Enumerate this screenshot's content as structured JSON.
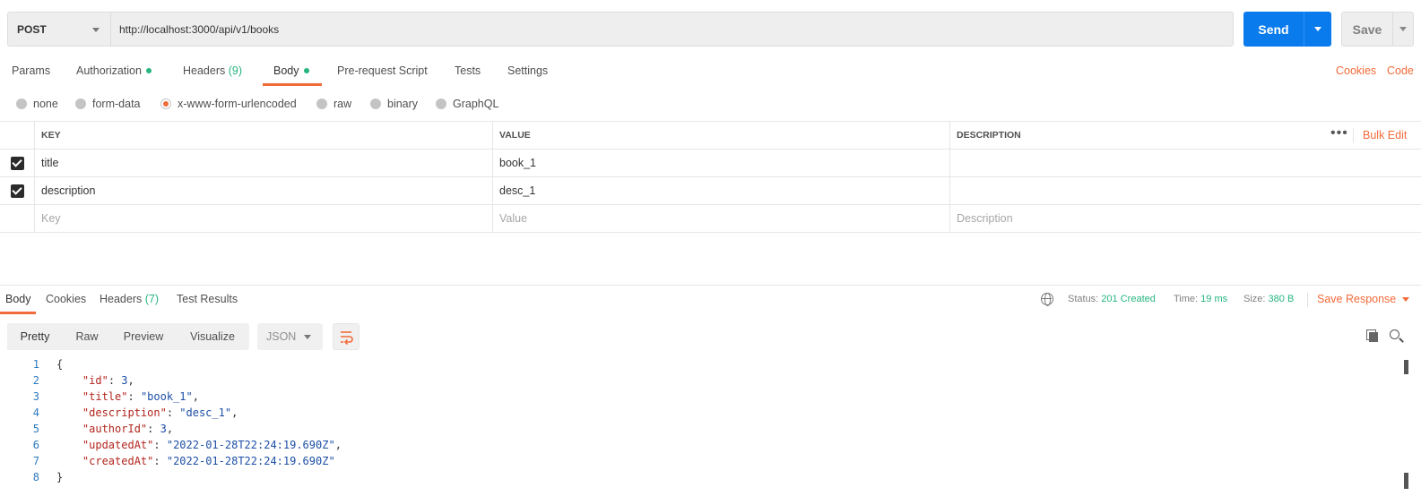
{
  "request": {
    "method": "POST",
    "url": "http://localhost:3000/api/v1/books",
    "send_label": "Send",
    "save_label": "Save"
  },
  "request_tabs": [
    {
      "label": "Params"
    },
    {
      "label": "Authorization"
    },
    {
      "label": "Headers",
      "count": "(9)"
    },
    {
      "label": "Body"
    },
    {
      "label": "Pre-request Script"
    },
    {
      "label": "Tests"
    },
    {
      "label": "Settings"
    }
  ],
  "right_links": {
    "cookies": "Cookies",
    "code": "Code"
  },
  "body_types": [
    "none",
    "form-data",
    "x-www-form-urlencoded",
    "raw",
    "binary",
    "GraphQL"
  ],
  "selected_body_type": "x-www-form-urlencoded",
  "params_table": {
    "headers": {
      "key": "KEY",
      "value": "VALUE",
      "description": "DESCRIPTION"
    },
    "more": "•••",
    "bulk_edit": "Bulk Edit",
    "rows": [
      {
        "key": "title",
        "value": "book_1",
        "description": "",
        "checked": true
      },
      {
        "key": "description",
        "value": "desc_1",
        "description": "",
        "checked": true
      }
    ],
    "placeholder": {
      "key": "Key",
      "value": "Value",
      "description": "Description"
    }
  },
  "response_tabs": [
    {
      "label": "Body"
    },
    {
      "label": "Cookies"
    },
    {
      "label": "Headers",
      "count": "(7)"
    },
    {
      "label": "Test Results"
    }
  ],
  "response_status": {
    "status_label": "Status:",
    "status_value": "201 Created",
    "time_label": "Time:",
    "time_value": "19 ms",
    "size_label": "Size:",
    "size_value": "380 B",
    "save_response": "Save Response"
  },
  "view_buttons": [
    "Pretty",
    "Raw",
    "Preview",
    "Visualize"
  ],
  "format": "JSON",
  "response_lines": [
    {
      "n": "1",
      "parts": [
        [
          "p",
          "{"
        ]
      ]
    },
    {
      "n": "2",
      "parts": [
        [
          "p",
          "    "
        ],
        [
          "k",
          "\"id\""
        ],
        [
          "p",
          ": "
        ],
        [
          "n",
          "3"
        ],
        [
          "p",
          ","
        ]
      ]
    },
    {
      "n": "3",
      "parts": [
        [
          "p",
          "    "
        ],
        [
          "k",
          "\"title\""
        ],
        [
          "p",
          ": "
        ],
        [
          "s",
          "\"book_1\""
        ],
        [
          "p",
          ","
        ]
      ]
    },
    {
      "n": "4",
      "parts": [
        [
          "p",
          "    "
        ],
        [
          "k",
          "\"description\""
        ],
        [
          "p",
          ": "
        ],
        [
          "s",
          "\"desc_1\""
        ],
        [
          "p",
          ","
        ]
      ]
    },
    {
      "n": "5",
      "parts": [
        [
          "p",
          "    "
        ],
        [
          "k",
          "\"authorId\""
        ],
        [
          "p",
          ": "
        ],
        [
          "n",
          "3"
        ],
        [
          "p",
          ","
        ]
      ]
    },
    {
      "n": "6",
      "parts": [
        [
          "p",
          "    "
        ],
        [
          "k",
          "\"updatedAt\""
        ],
        [
          "p",
          ": "
        ],
        [
          "s",
          "\"2022-01-28T22:24:19.690Z\""
        ],
        [
          "p",
          ","
        ]
      ]
    },
    {
      "n": "7",
      "parts": [
        [
          "p",
          "    "
        ],
        [
          "k",
          "\"createdAt\""
        ],
        [
          "p",
          ": "
        ],
        [
          "s",
          "\"2022-01-28T22:24:19.690Z\""
        ]
      ]
    },
    {
      "n": "8",
      "parts": [
        [
          "p",
          "}"
        ]
      ]
    }
  ],
  "colors": {
    "accent": "#f26b3a",
    "send": "#097bed",
    "success": "#26b47f"
  }
}
